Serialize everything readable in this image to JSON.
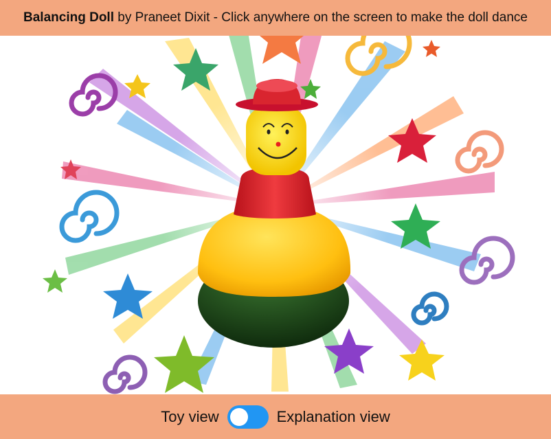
{
  "header": {
    "title_bold": "Balancing Doll",
    "title_rest": " by Praneet Dixit - Click anywhere on the screen to make the doll dance"
  },
  "footer": {
    "left_label": "Toy view",
    "right_label": "Explanation view",
    "toggle_state": "toy"
  },
  "scene": {
    "background_colors": [
      "#e34b8a",
      "#ffd23a",
      "#4aa3e8",
      "#57c26b",
      "#b65fd6",
      "#ff8a3d"
    ],
    "doll_colors": {
      "hat": "#d9252f",
      "face": "#ffdf1f",
      "collar": "#e0262c",
      "belly": "#ffc21a",
      "base": "#1f4a1c"
    }
  }
}
